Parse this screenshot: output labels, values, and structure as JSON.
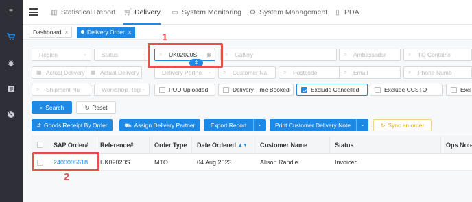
{
  "nav": {
    "items": [
      {
        "label": "Statistical Report",
        "icon": "chart-icon"
      },
      {
        "label": "Delivery",
        "icon": "cart-icon"
      },
      {
        "label": "System Monitoring",
        "icon": "monitor-icon"
      },
      {
        "label": "System Management",
        "icon": "gear-icon"
      },
      {
        "label": "PDA",
        "icon": "phone-icon"
      }
    ],
    "active": "Delivery"
  },
  "tabs": [
    {
      "label": "Dashboard",
      "close": "×"
    },
    {
      "label": "Delivery Order",
      "close": "×"
    }
  ],
  "filters": {
    "row1": {
      "region": "Region",
      "status": "Status",
      "search_value": "UK02020S",
      "gallery": "Gallery",
      "ambassador": "Ambassador",
      "to_container": "TO Containe"
    },
    "row2": {
      "actual_delivery_from": "Actual Delivery I",
      "actual_delivery_to": "Actual Delivery I",
      "delivery_partner": "Delivery Partne",
      "customer_name": "Customer Na",
      "postcode": "Postcode",
      "email": "Email",
      "phone": "Phone Numb"
    },
    "row3": {
      "shipment_no": "Shipment Nu",
      "workshop_region": "Workshop Regi",
      "pod_uploaded": "POD Uploaded",
      "delivery_time_booked": "Delivery Time Booked",
      "exclude_cancelled": "Exclude Cancelled",
      "exclude_ccsto": "Exclude CCSTO",
      "exclude_other": "Excl"
    }
  },
  "buttons": {
    "search": "Search",
    "reset": "Reset",
    "goods_receipt": "Goods Receipt By Order",
    "assign_partner": "Assign Delivery Partner",
    "export_report": "Export Report",
    "print_note": "Print Customer Delivery Note",
    "sync_order": "Sync an order"
  },
  "table": {
    "headers": [
      "SAP Order#",
      "Reference#",
      "Order Type",
      "Date Ordered",
      "Customer Name",
      "Status",
      "Ops Note"
    ],
    "rows": [
      {
        "sap_order": "2400005618",
        "reference": "UK02020S",
        "order_type": "MTO",
        "date_ordered": "04 Aug 2023",
        "customer_name": "Alison Randle",
        "status": "Invoiced"
      }
    ]
  },
  "annotations": {
    "step1": "1",
    "step2": "2"
  },
  "colors": {
    "accent": "#1e88e5",
    "sidebar": "#2f3037",
    "highlight": "#e2514c",
    "warning": "#e6a817"
  }
}
